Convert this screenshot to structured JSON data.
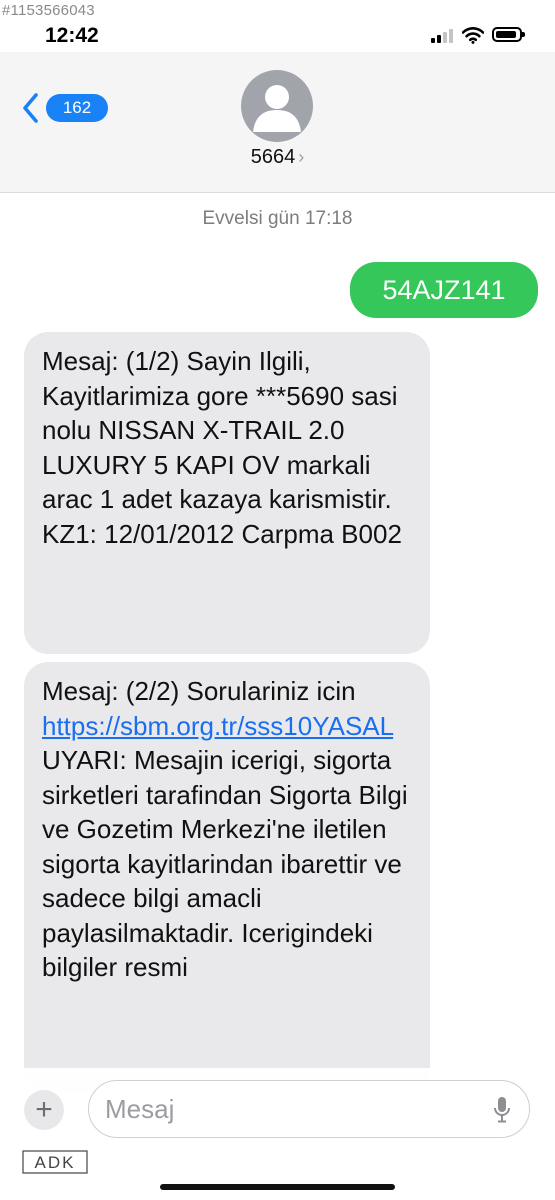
{
  "watermark_id": "#1153566043",
  "status_bar": {
    "time": "12:42"
  },
  "header": {
    "back_badge": "162",
    "contact_name": "5664",
    "contact_chevron": "›"
  },
  "conversation": {
    "timestamp": "Evvelsi gün 17:18",
    "sent_message": "54AJZ141",
    "received_1": "Mesaj: (1/2) Sayin Ilgili, Kayitlarimiza gore ***5690 sasi nolu NISSAN X-TRAIL 2.0 LUXURY 5 KAPI OV markali arac 1 adet kazaya karismistir. KZ1: 12/01/2012 Carpma B002",
    "received_2": {
      "before_link": "Mesaj: (2/2) Sorulariniz icin ",
      "link": "https://sbm.org.tr/sss10YASAL",
      "after_link": " UYARI: Mesajin icerigi, sigorta sirketleri tarafindan Sigorta Bilgi ve Gozetim Merkezi'ne iletilen sigorta kayitlarindan ibarettir ve sadece bilgi amacli paylasilmaktadir. Icerigindeki bilgiler resmi"
    }
  },
  "composer": {
    "plus_label": "+",
    "placeholder": "Mesaj"
  },
  "logo_text": "ADK",
  "colors": {
    "sent_bubble": "#35c759",
    "received_bubble": "#e9e9eb",
    "link": "#1a6ff0",
    "badge": "#1a82f7"
  },
  "icons": [
    "signal-icon",
    "wifi-icon",
    "battery-icon",
    "back-chevron-icon",
    "person-avatar-icon",
    "plus-icon",
    "mic-icon"
  ]
}
